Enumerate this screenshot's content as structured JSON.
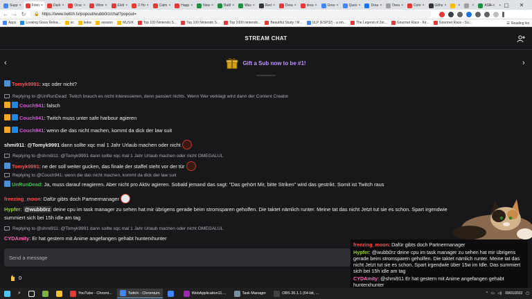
{
  "browser": {
    "tabs": [
      {
        "label": "Supp",
        "color": "#4285f4"
      },
      {
        "label": "Frien",
        "color": "#e53935"
      },
      {
        "label": "Dark",
        "color": "#e53935"
      },
      {
        "label": "Orac",
        "color": "#e53935"
      },
      {
        "label": "Winn",
        "color": "#e53935"
      },
      {
        "label": "Eleti",
        "color": "#e53935"
      },
      {
        "label": "2 Ho",
        "color": "#e53935"
      },
      {
        "label": "Calm",
        "color": "#e53935"
      },
      {
        "label": "Happ",
        "color": "#e53935"
      },
      {
        "label": "New",
        "color": "#1e8e3e"
      },
      {
        "label": "Battl",
        "color": "#1e8e3e"
      },
      {
        "label": "Was",
        "color": "#1e8e3e"
      },
      {
        "label": "Red",
        "color": "#333333"
      },
      {
        "label": "Drea",
        "color": "#e53935"
      },
      {
        "label": "drea",
        "color": "#e53935"
      },
      {
        "label": "Gree",
        "color": "#4285f4"
      },
      {
        "label": "Ques",
        "color": "#4285f4"
      },
      {
        "label": "Drea",
        "color": "#1a73e8"
      },
      {
        "label": "Drea",
        "color": "#9e9e9e"
      },
      {
        "label": "Com",
        "color": "#e53935"
      },
      {
        "label": "Githu",
        "color": "#333333"
      },
      {
        "label": "",
        "color": "#fbbc04"
      },
      {
        "label": "",
        "color": "#9e9e9e"
      },
      {
        "label": "ASR",
        "color": "#1e8e3e"
      }
    ],
    "url": "https://www.twitch.tv/popout/wubb0rz/chat?popout=",
    "bookmarks": [
      {
        "label": "Apps",
        "color": "#4285f4"
      },
      {
        "label": "Looking Glass Relea...",
        "color": "#1e88e5"
      },
      {
        "label": "sc",
        "color": "#fbbc04"
      },
      {
        "label": "kekw",
        "color": "#fbbc04"
      },
      {
        "label": "session",
        "color": "#fbbc04"
      },
      {
        "label": "MUSIK",
        "color": "#fbbc04"
      },
      {
        "label": "Top 100 Nintendo S...",
        "color": "#e53935"
      },
      {
        "label": "Top 100 Nintendo S...",
        "color": "#e53935"
      },
      {
        "label": "Top 1000 nintendo...",
        "color": "#e53935"
      },
      {
        "label": "Beautiful Study / M...",
        "color": "#e53935"
      },
      {
        "label": "ULP (ESP32) - a sm...",
        "color": "#4285f4"
      },
      {
        "label": "The Legend of Zel...",
        "color": "#e53935"
      },
      {
        "label": "Gourmet Race - Kir...",
        "color": "#e53935"
      },
      {
        "label": "Gourmet Race - Su...",
        "color": "#e53935"
      }
    ],
    "reading_list": "Reading list"
  },
  "chat": {
    "title": "STREAM CHAT",
    "gift_banner": "Gift a Sub now to be #1!",
    "send_placeholder": "Send a message",
    "points": "0"
  },
  "messages": [
    {
      "user": "Tomyk9991",
      "user_color": "#ff4f4f",
      "badges": [
        "#4a90d9"
      ],
      "text": ": xqc oder nicht?"
    },
    {
      "reply": "Replying to @UnRunDead: Twitch brauch es nicht interessieren, denn passiert nichts. Wenn Wer verklagt wird dann der Content Creator"
    },
    {
      "user": "Couch941",
      "user_color": "#d35ad6",
      "badges": [
        "#f5a623",
        "#1e88e5"
      ],
      "text": ": falsch"
    },
    {
      "user": "Couch941",
      "user_color": "#d35ad6",
      "badges": [
        "#f5a623",
        "#1e88e5"
      ],
      "text": ": Twitch muss unter safe harbour agieren"
    },
    {
      "user": "Couch941",
      "user_color": "#d35ad6",
      "badges": [
        "#f5a623",
        "#1e88e5"
      ],
      "text": ": wenn die das nicht machen, kommt da dick der law suit"
    },
    {
      "user": "shmi911",
      "user_color": "#efeff1",
      "badges": [],
      "mention": "@Tomyk9991",
      "text": " dann sollte xqc mal 1 Jahr Urlaub machen oder nicht"
    },
    {
      "reply": "Replying to @shmi911: @Tomyk9991 dann sollte xqc mal 1 Jahr Urlaub machen oder nicht OMEGALUL"
    },
    {
      "user": "Tomyk9991",
      "user_color": "#ff4f4f",
      "badges": [
        "#4a90d9"
      ],
      "text": ": ne der soll weiter gucken, das finale der staffel steht vor der tür"
    },
    {
      "reply": "Replying to @Couch941: wenn die das nicht machen, kommt da dick der law suit"
    },
    {
      "user": "UnRunDead",
      "user_color": "#2ecc40",
      "badges": [
        "#4a90d9"
      ],
      "text": ": Ja, muss darauf reagieren. Aber nicht pro Aktiv agieren. Sobald jemand das sagt: \"Das gehört Mir, bitte Striken\" wird das gestrikt. Somit ist Twitch raus"
    },
    {
      "user": "freezing_moon",
      "user_color": "#ff4f4f",
      "badges": [],
      "text": ": Dafür gibts doch Partnermanager"
    },
    {
      "user": "Hypfer",
      "user_color": "#9acd32",
      "badges": [],
      "mention": "@wubb0rz",
      "text": " deine cpu im task manager zu sehen hat mir übrigens gerade beim stromsparen geholfen. Die taktet nämlich runter. Meine tat das nicht Jetzt tut sie es schon. Spart irgendwie 15w im Idle. Das summiert sich bei 15h idle am tag"
    },
    {
      "reply": "Replying to @shmi911: @Tomyk9991 dann sollte xqc mal 1 Jahr Urlaub machen oder nicht OMEGALUL"
    },
    {
      "user": "CYDAmity",
      "user_color": "#ff69b4",
      "badges": [],
      "text": ": Er hat gestern mit Anime angefangen gehabt hunterxhunter"
    }
  ],
  "overlay": [
    {
      "user": "freezing_moon",
      "user_color": "#ff4f4f",
      "text": ": Dafür gibts doch Partnermanager"
    },
    {
      "user": "Hypfer",
      "user_color": "#9acd32",
      "text": ": @wubb0rz deine cpu im task manager zu sehen hat mir übrigens gerade beim stromsparen geholfen. Die taktet nämlich runter. Meine tat das nicht Jetzt tut sie es schon. Spart irgendwie über 15w im Idle. Das summiert sich bei 15h idle am tag"
    },
    {
      "user": "CYDAmity",
      "user_color": "#ff69b4",
      "text": ": @shmi911 Er hat gestern mit Anime angefangen gehabt hunterxhunter"
    }
  ],
  "taskbar": {
    "items": [
      {
        "label": "YouTube - Chromi...",
        "color": "#e53935",
        "active": false
      },
      {
        "label": "Twitch - Chromium",
        "color": "#4285f4",
        "active": true
      },
      {
        "label": "",
        "color": "#4285f4",
        "active": false
      },
      {
        "label": "WebApplication11....",
        "color": "#9c27b0",
        "active": false
      },
      {
        "label": "Task Manager",
        "color": "#78909c",
        "active": false
      },
      {
        "label": "OBS 26.1.1 (64-bit, ...",
        "color": "#424242",
        "active": false
      }
    ],
    "date": "09/01/2022"
  }
}
